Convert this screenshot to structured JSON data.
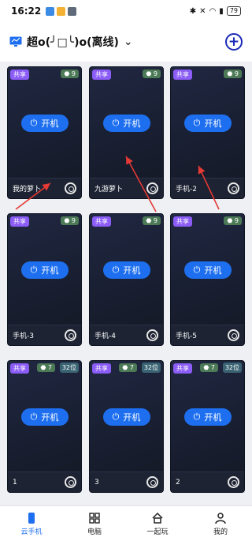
{
  "status_bar": {
    "time": "16:22",
    "battery": "79"
  },
  "header": {
    "title": "超o(╯□╰)o(离线)"
  },
  "cards": [
    {
      "share": "共享",
      "android": "9",
      "bits": "",
      "power": "开机",
      "name": "我的萝卜"
    },
    {
      "share": "共享",
      "android": "9",
      "bits": "",
      "power": "开机",
      "name": "九游萝卜"
    },
    {
      "share": "共享",
      "android": "9",
      "bits": "",
      "power": "开机",
      "name": "手机-2"
    },
    {
      "share": "共享",
      "android": "9",
      "bits": "",
      "power": "开机",
      "name": "手机-3"
    },
    {
      "share": "共享",
      "android": "9",
      "bits": "",
      "power": "开机",
      "name": "手机-4"
    },
    {
      "share": "共享",
      "android": "9",
      "bits": "",
      "power": "开机",
      "name": "手机-5"
    },
    {
      "share": "共享",
      "android": "7",
      "bits": "32位",
      "power": "开机",
      "name": "1"
    },
    {
      "share": "共享",
      "android": "7",
      "bits": "32位",
      "power": "开机",
      "name": "3"
    },
    {
      "share": "共享",
      "android": "7",
      "bits": "32位",
      "power": "开机",
      "name": "2"
    }
  ],
  "nav": [
    {
      "label": "云手机",
      "icon": "phone-icon"
    },
    {
      "label": "电脑",
      "icon": "grid-icon"
    },
    {
      "label": "一起玩",
      "icon": "home-icon"
    },
    {
      "label": "我的",
      "icon": "user-icon"
    }
  ],
  "colors": {
    "accent": "#1d6ff0",
    "share_badge": "#8b5cf6",
    "android_badge": "#4c7a56",
    "arrow": "#e53935"
  }
}
